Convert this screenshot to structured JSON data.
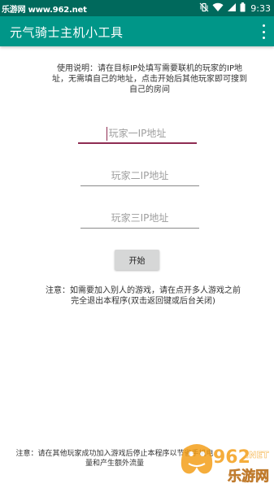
{
  "status_bar": {
    "watermark": "乐游网 www.962.net",
    "time": "9:33",
    "icons": [
      "vibrate-icon",
      "wifi-icon",
      "signal-icon",
      "battery-icon"
    ]
  },
  "app_bar": {
    "title": "元气骑士主机小工具",
    "menu_icon": "more-vert-icon"
  },
  "main": {
    "instructions": "使用说明：请在目标IP处填写需要联机的玩家的IP地址，无需填自己的地址，点击开始后其他玩家即可搜到自己的房间",
    "inputs": [
      {
        "placeholder": "玩家一IP地址",
        "value": ""
      },
      {
        "placeholder": "玩家二IP地址",
        "value": ""
      },
      {
        "placeholder": "玩家三IP地址",
        "value": ""
      }
    ],
    "start_button": "开始",
    "note": "注意：如需要加入别人的游戏，请在点开多人游戏之前完全退出本程序(双击返回键或后台关闭)"
  },
  "footer": {
    "note": "注意：请在其他玩家成功加入游戏后停止本程序以节省手机电量和产生额外流量",
    "watermark_badge": {
      "number": "962",
      "tld": ".NET",
      "name": "乐游网"
    }
  },
  "colors": {
    "status_bar": "#00695c",
    "app_bar": "#009688",
    "focus_accent": "#8e2c52",
    "button_bg": "#d6d7d7",
    "badge_orange": "#f39c12"
  }
}
